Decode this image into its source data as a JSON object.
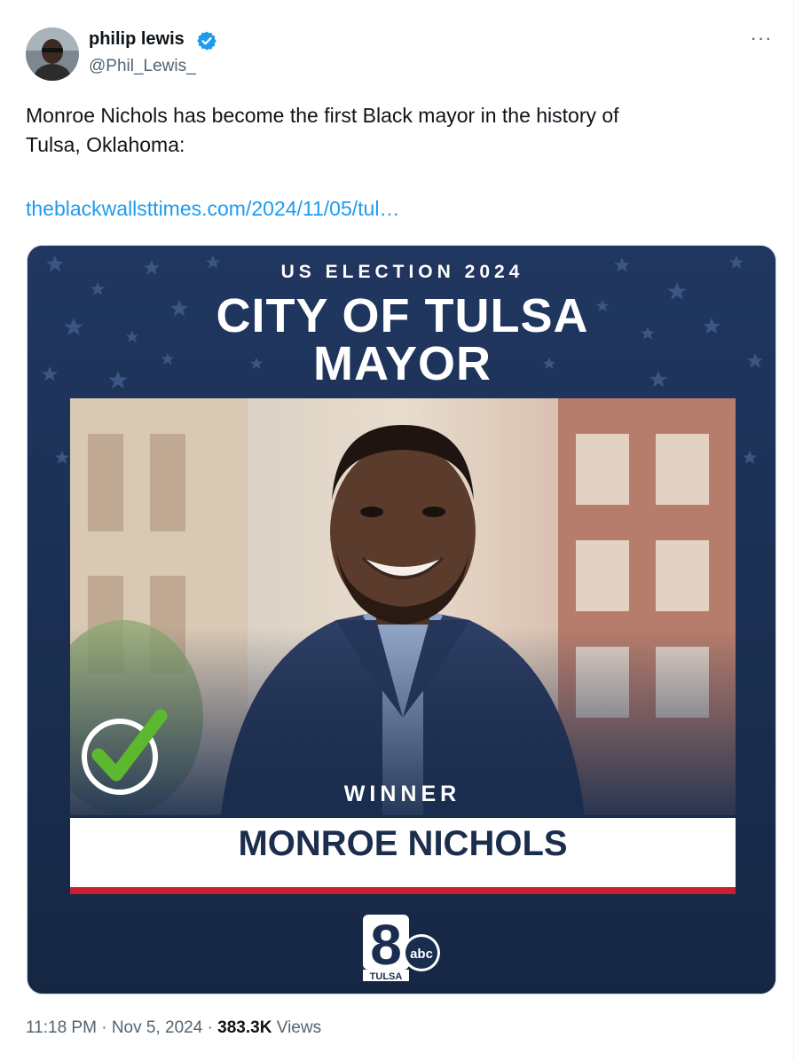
{
  "author": {
    "display_name": "philip lewis",
    "handle": "@Phil_Lewis_",
    "verified_icon": "verified-badge-icon"
  },
  "actions": {
    "more_label": "···"
  },
  "tweet": {
    "text": "Monroe Nichols has become the first Black mayor in the history of\nTulsa, Oklahoma:",
    "link_text": "theblackwallsttimes.com/2024/11/05/tul…"
  },
  "media": {
    "supertitle": "US ELECTION 2024",
    "title_line1": "CITY OF TULSA",
    "title_line2": "MAYOR",
    "winner_label": "WINNER",
    "candidate_name": "MONROE NICHOLS",
    "logo_number": "8",
    "logo_network": "abc",
    "logo_city": "TULSA",
    "colors": {
      "navy": "#1a2d4e",
      "red_rule": "#c8202e",
      "check_green": "#5cb82e"
    }
  },
  "footer": {
    "time": "11:18 PM",
    "date": "Nov 5, 2024",
    "views_count": "383.3K",
    "views_label": "Views",
    "separator": "·"
  }
}
